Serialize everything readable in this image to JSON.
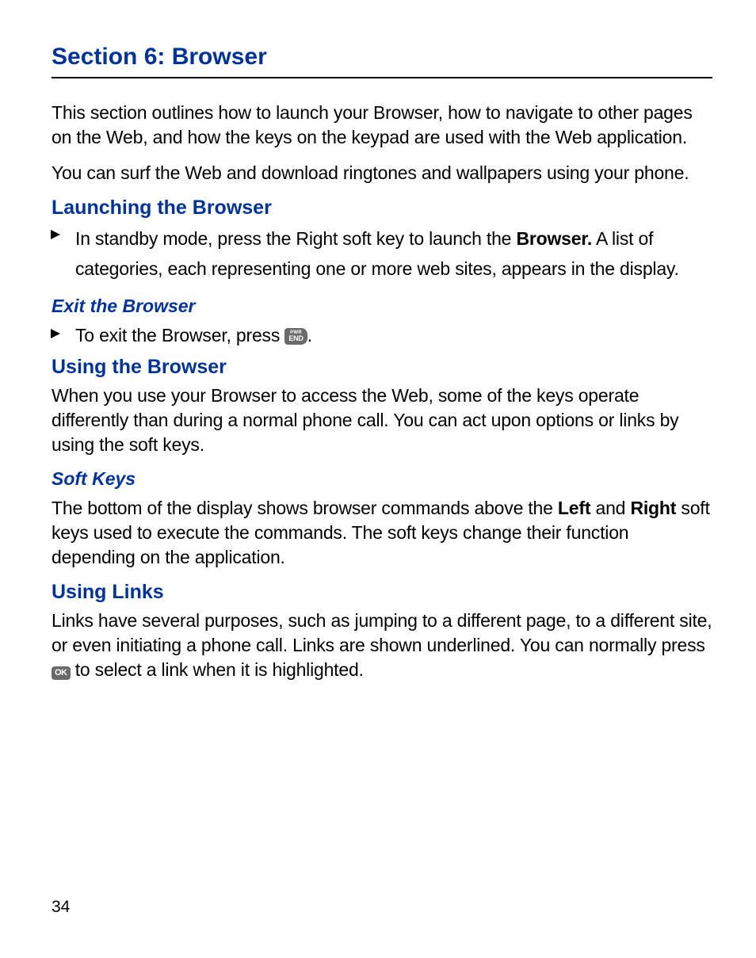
{
  "section_title": "Section 6: Browser",
  "intro_p1": "This section outlines how to launch your Browser, how to navigate to other pages on the Web, and how the keys on the keypad are used with the Web application.",
  "intro_p2": "You can surf the Web and download ringtones and wallpapers using your phone.",
  "h_launching": "Launching the Browser",
  "launch_bullet_pre": "In standby mode, press the Right soft key to launch the ",
  "launch_bullet_bold": "Browser.",
  "launch_bullet_post": " A list of categories, each representing one or more web sites, appears in the display.",
  "h_exit": "Exit the Browser",
  "exit_bullet_pre": "To exit the Browser, press ",
  "exit_bullet_post": ".",
  "key_end_top": "PWR",
  "key_end_main": "END",
  "h_using": "Using the Browser",
  "using_p": "When you use your Browser to access the Web, some of the keys operate differently than during a normal phone call. You can act upon options or links by using the soft keys.",
  "h_softkeys": "Soft Keys",
  "softkeys_pre": "The bottom of the display shows browser commands above the ",
  "softkeys_left": "Left",
  "softkeys_mid": " and ",
  "softkeys_right": "Right",
  "softkeys_post": " soft keys used to execute the commands. The soft keys change their function depending on the application.",
  "h_links": "Using Links",
  "links_pre": "Links have several purposes, such as jumping to a different page, to a different site, or even initiating a phone call. Links are shown underlined. You can normally press ",
  "links_post": " to select a link when it is highlighted.",
  "key_ok": "OK",
  "page_number": "34"
}
